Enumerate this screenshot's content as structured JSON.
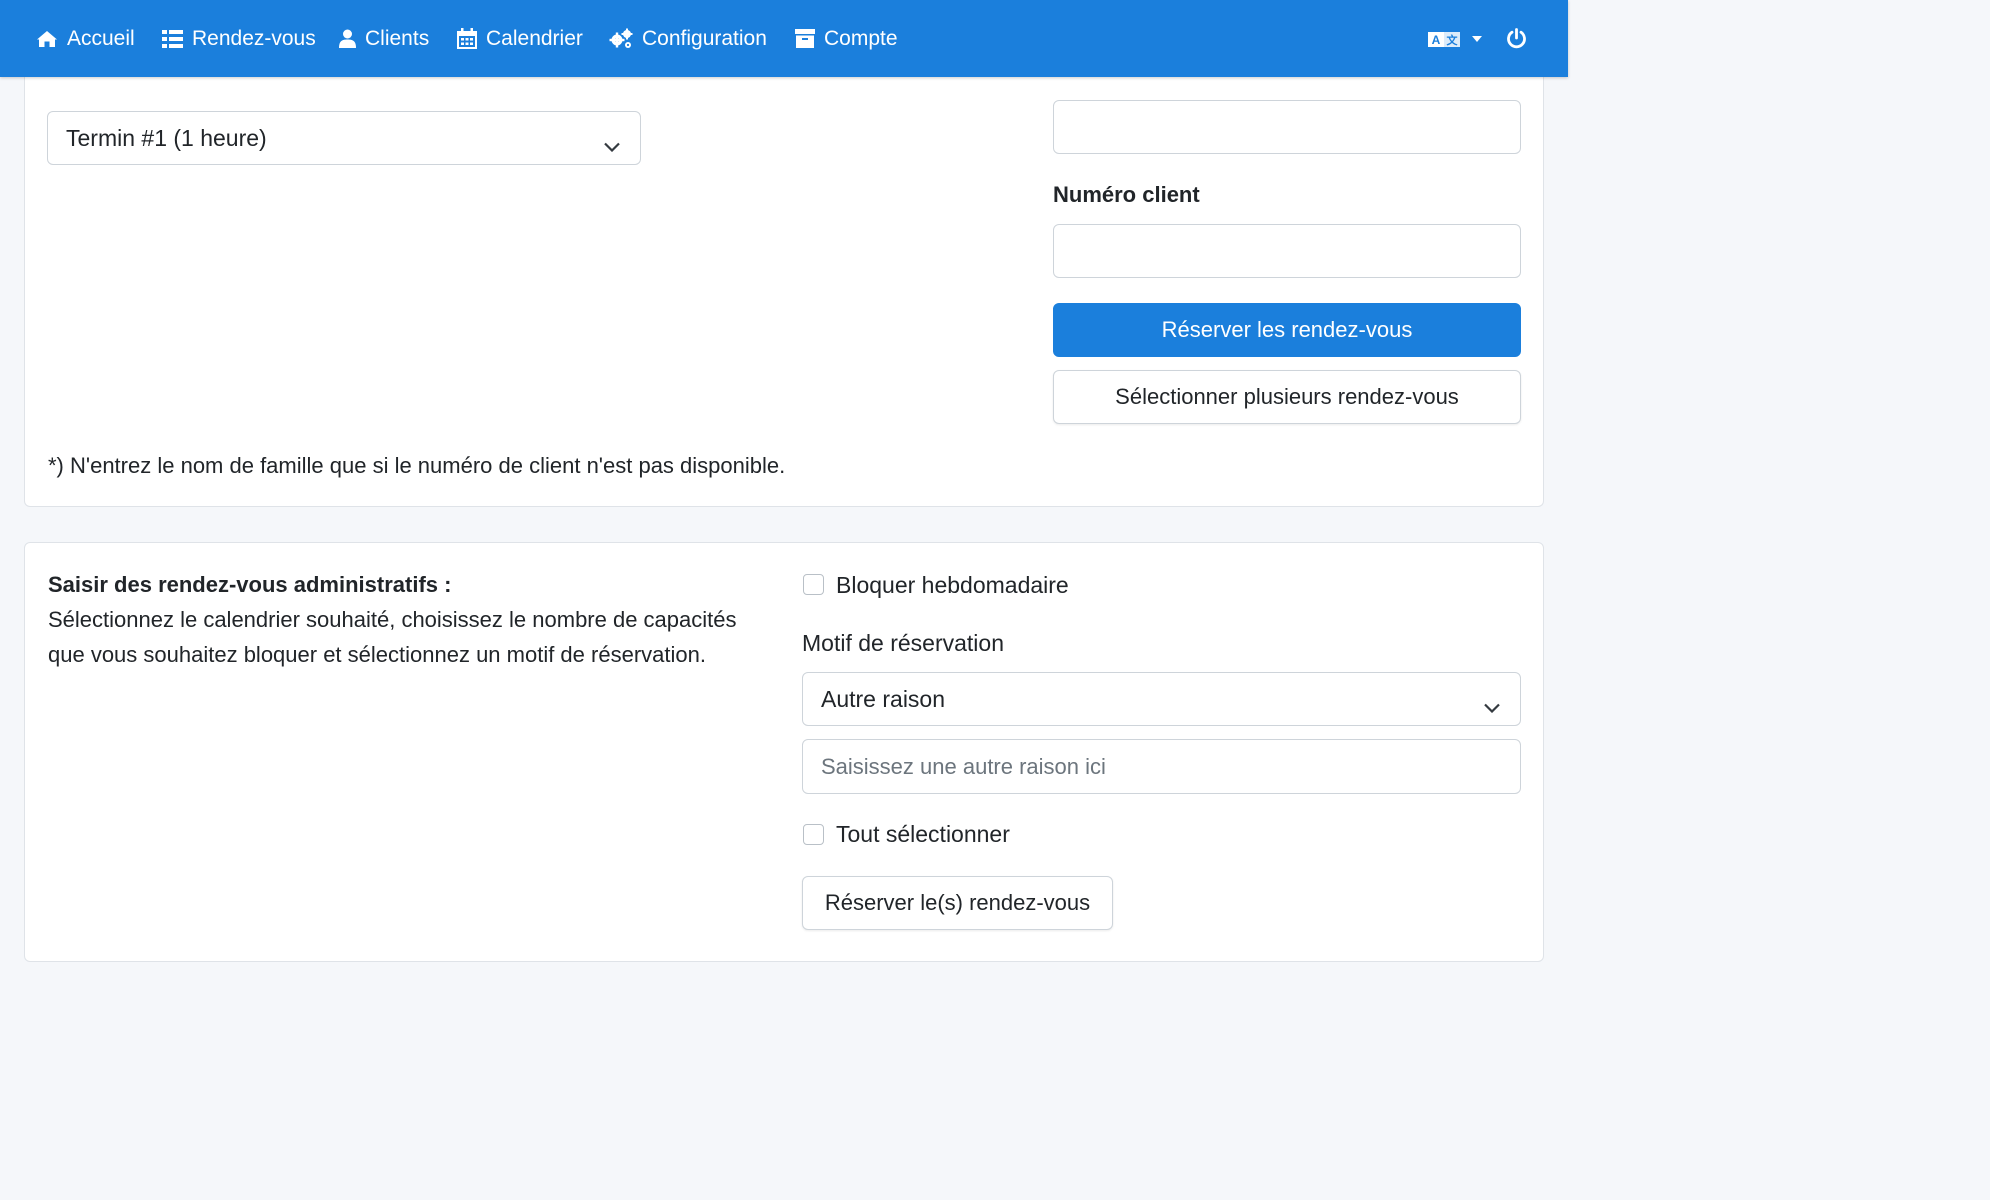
{
  "nav": {
    "items": [
      {
        "label": "Accueil",
        "icon": "home-icon"
      },
      {
        "label": "Rendez-vous",
        "icon": "list-icon"
      },
      {
        "label": "Clients",
        "icon": "user-icon"
      },
      {
        "label": "Calendrier",
        "icon": "calendar-icon"
      },
      {
        "label": "Configuration",
        "icon": "gears-icon"
      },
      {
        "label": "Compte",
        "icon": "archive-icon"
      }
    ],
    "language_icon": "translate-icon",
    "power_icon": "power-icon"
  },
  "booking": {
    "calendar_select_value": "Termin #1 (1 heure)",
    "top_input_value": "",
    "customer_number_label": "Numéro client",
    "customer_number_value": "",
    "book_button": "Réserver les rendez-vous",
    "select_multiple_button": "Sélectionner plusieurs rendez-vous",
    "footnote": "*) N'entrez le nom de famille que si le numéro de client n'est pas disponible."
  },
  "admin": {
    "heading": "Saisir des rendez-vous administratifs :",
    "description": "Sélectionnez le calendrier souhaité, choisissez le nombre de capacités que vous souhaitez bloquer et sélectionnez un motif de réservation.",
    "weekly_block_label": "Bloquer hebdomadaire",
    "reason_label": "Motif de réservation",
    "reason_select_value": "Autre raison",
    "other_reason_placeholder": "Saisissez une autre raison ici",
    "select_all_label": "Tout sélectionner",
    "book_button": "Réserver le(s) rendez-vous"
  },
  "colors": {
    "primary": "#1b7fdc",
    "background": "#f5f7fa"
  }
}
